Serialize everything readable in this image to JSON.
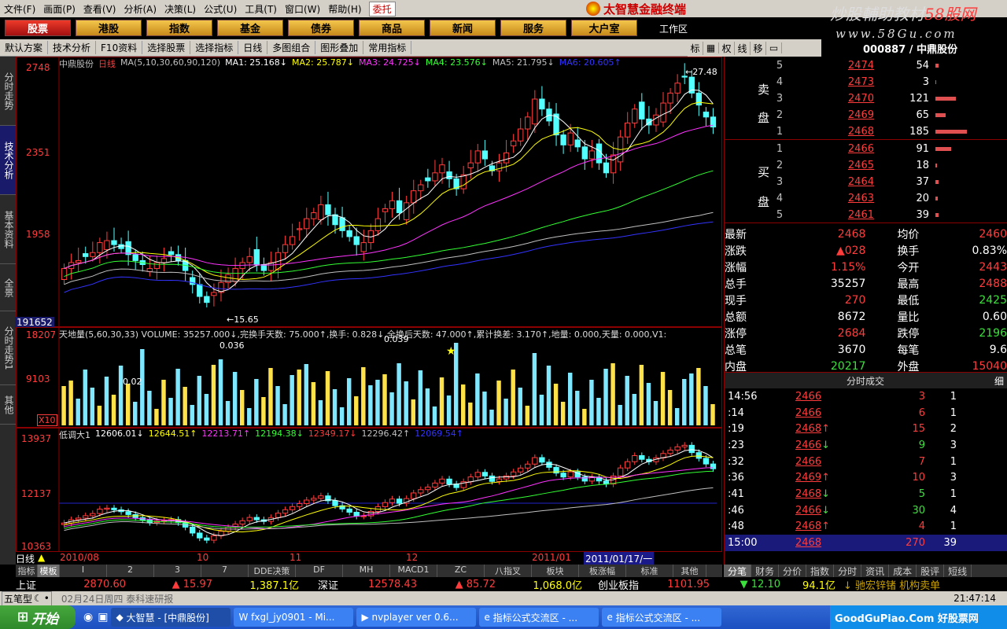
{
  "menu": [
    "文件(F)",
    "画面(P)",
    "查看(V)",
    "分析(A)",
    "决策(L)",
    "公式(U)",
    "工具(T)",
    "窗口(W)",
    "帮助(H)"
  ],
  "entrust": "委托",
  "brand": "太智慧金融终端",
  "watermark": {
    "line1a": "炒股輔助教材",
    "line1b": "58股网",
    "line2": "www.58Gu.com"
  },
  "nav": [
    "股票",
    "港股",
    "指数",
    "基金",
    "债券",
    "商品",
    "新闻",
    "服务",
    "大户室"
  ],
  "workspace": "工作区",
  "toolbar": [
    "默认方案",
    "技术分析",
    "F10资料",
    "选择股票",
    "选择指标",
    "日线",
    "多图组合",
    "图形叠加",
    "常用指标"
  ],
  "toolbar2": [
    "标",
    "",
    "权",
    "线",
    "移",
    ""
  ],
  "lefttabs": [
    "分时走势",
    "技术分析",
    "基本资料",
    "全景",
    "分时走势1",
    "其他"
  ],
  "main": {
    "info_name": "中鼎股份",
    "info_period": "日线",
    "info_ma": "MA(5,10,30,60,90,120)",
    "ma1": "MA1: 25.168↓",
    "ma2": "MA2: 25.787↓",
    "ma3": "MA3: 24.725↓",
    "ma4": "MA4: 23.576↓",
    "ma5": "MA5: 21.795↓",
    "ma6": "MA6: 20.605↑",
    "axis": [
      "2748",
      "2351",
      "1958"
    ],
    "high_label": "←27.48",
    "low_label": "←15.65",
    "corner_value": "191652"
  },
  "vol": {
    "header": "天地量(5,60,30,33) VOLUME: 35257.000↓,完换手天数: 75.000↑,换手: 0.828↓,全换后天数: 47.000↑,累计换差: 3.170↑,地量: 0.000,天量: 0.000,V1:",
    "axis": [
      "18207",
      "9103"
    ],
    "x10": "X10",
    "labels": [
      "0.036",
      "0.039",
      "0.02"
    ]
  },
  "ind": {
    "name": "低调大1",
    "values": [
      "12606.01↓",
      "12644.51↑",
      "12213.71↑",
      "12194.38↓",
      "12349.17↓",
      "12296.42↑",
      "12069.54↑"
    ],
    "axis": [
      "13937",
      "12137",
      "10363"
    ]
  },
  "dates": [
    "2010/08",
    "10",
    "11",
    "12",
    "2011/01",
    "2011/01/17/一"
  ],
  "period": "日线",
  "bottomtabs": [
    "指标",
    "模板",
    "I",
    "2",
    "3",
    "7",
    "DDE决策",
    "DF",
    "MH",
    "MACD1",
    "ZC",
    "八指叉",
    "板块",
    "板涨幅",
    "标准",
    "其他"
  ],
  "quote": {
    "code": "000887 / 中鼎股份",
    "sell_label": [
      "卖",
      "盘"
    ],
    "buy_label": [
      "买",
      "盘"
    ],
    "sell": [
      {
        "level": "5",
        "price": "2474",
        "vol": "54",
        "bar": 0.09
      },
      {
        "level": "4",
        "price": "2473",
        "vol": "3",
        "bar": 0.02
      },
      {
        "level": "3",
        "price": "2470",
        "vol": "121",
        "bar": 0.6
      },
      {
        "level": "2",
        "price": "2469",
        "vol": "65",
        "bar": 0.3
      },
      {
        "level": "1",
        "price": "2468",
        "vol": "185",
        "bar": 0.92
      }
    ],
    "buy": [
      {
        "level": "1",
        "price": "2466",
        "vol": "91",
        "bar": 0.45
      },
      {
        "level": "2",
        "price": "2465",
        "vol": "18",
        "bar": 0.05
      },
      {
        "level": "3",
        "price": "2464",
        "vol": "37",
        "bar": 0.1
      },
      {
        "level": "4",
        "price": "2463",
        "vol": "20",
        "bar": 0.06
      },
      {
        "level": "5",
        "price": "2461",
        "vol": "39",
        "bar": 0.1
      }
    ],
    "stats": [
      {
        "k1": "最新",
        "v1": "2468",
        "c1": "#ff3c3c",
        "k2": "均价",
        "v2": "2460",
        "c2": "#ff3c3c"
      },
      {
        "k1": "涨跌",
        "v1": "▲028",
        "c1": "#ff3c3c",
        "k2": "换手",
        "v2": "0.83%",
        "c2": "#fff"
      },
      {
        "k1": "涨幅",
        "v1": "1.15%",
        "c1": "#ff3c3c",
        "k2": "今开",
        "v2": "2443",
        "c2": "#ff3c3c"
      },
      {
        "k1": "总手",
        "v1": "35257",
        "c1": "#fff",
        "k2": "最高",
        "v2": "2488",
        "c2": "#ff3c3c"
      },
      {
        "k1": "现手",
        "v1": "270",
        "c1": "#ff3c3c",
        "k2": "最低",
        "v2": "2425",
        "c2": "#3ce03c"
      },
      {
        "k1": "总额",
        "v1": "8672",
        "c1": "#fff",
        "k2": "量比",
        "v2": "0.60",
        "c2": "#fff"
      },
      {
        "k1": "涨停",
        "v1": "2684",
        "c1": "#ff3c3c",
        "k2": "跌停",
        "v2": "2196",
        "c2": "#3ce03c"
      },
      {
        "k1": "总笔",
        "v1": "3670",
        "c1": "#fff",
        "k2": "每笔",
        "v2": "9.6",
        "c2": "#fff"
      },
      {
        "k1": "内盘",
        "v1": "20217",
        "c1": "#3ce03c",
        "k2": "外盘",
        "v2": "15040",
        "c2": "#ff3c3c"
      }
    ],
    "trades_header": "分时成交",
    "trades_btn": "细",
    "trades": [
      {
        "t": "14:56",
        "p": "2466",
        "a": "",
        "q": "3",
        "qc": "#ff3c3c",
        "n": "1"
      },
      {
        "t": ":14",
        "p": "2466",
        "a": "",
        "q": "6",
        "qc": "#ff3c3c",
        "n": "1"
      },
      {
        "t": ":19",
        "p": "2468",
        "a": "↑",
        "q": "15",
        "qc": "#ff3c3c",
        "n": "2"
      },
      {
        "t": ":23",
        "p": "2466",
        "a": "↓",
        "q": "9",
        "qc": "#3ce03c",
        "n": "3"
      },
      {
        "t": ":32",
        "p": "2466",
        "a": "",
        "q": "7",
        "qc": "#ff3c3c",
        "n": "1"
      },
      {
        "t": ":36",
        "p": "2469",
        "a": "↑",
        "q": "10",
        "qc": "#ff3c3c",
        "n": "3"
      },
      {
        "t": ":41",
        "p": "2468",
        "a": "↓",
        "q": "5",
        "qc": "#3ce03c",
        "n": "1"
      },
      {
        "t": ":46",
        "p": "2466",
        "a": "↓",
        "q": "30",
        "qc": "#3ce03c",
        "n": "4"
      },
      {
        "t": ":48",
        "p": "2468",
        "a": "↑",
        "q": "4",
        "qc": "#ff3c3c",
        "n": "1"
      }
    ],
    "last_trade": {
      "t": "15:00",
      "p": "2468",
      "q": "270",
      "n": "39"
    }
  },
  "righttabs": [
    "分笔",
    "财务",
    "分价",
    "指数",
    "分时",
    "资讯",
    "成本",
    "股评",
    "短线"
  ],
  "ticker": {
    "sh_name": "上证",
    "sh_val": "2870.60",
    "sh_chg": "▲ 15.97",
    "sh_amt": "1,387.1亿",
    "sz_name": "深证",
    "sz_val": "12578.43",
    "sz_chg": "▲ 85.72",
    "sz_amt": "1,068.0亿",
    "cy_name": "创业板指",
    "cy_val": "1101.95",
    "cy_chg": "▼ 12.10",
    "cy_amt": "94.1亿",
    "news": "↓ 驰宏锌锗 机构卖单"
  },
  "status": {
    "wubi": "五笔型",
    "info": "02月24日周四 泰科速研报",
    "time": "21:47:14"
  },
  "taskbar": {
    "start": "开始",
    "tasks": [
      "大智慧 - [中鼎股份]",
      "fxgl_jy0901 - Mi...",
      "nvplayer ver 0.6...",
      "指标公式交流区 - ...",
      "指标公式交流区 - ..."
    ],
    "tray": "GoodGuPiao.Com 好股票网"
  },
  "chart_data": {
    "type": "candlestick",
    "title": "中鼎股份 日线",
    "ylim": [
      15.65,
      27.48
    ],
    "x_labels": [
      "2010/08",
      "10",
      "11",
      "12",
      "2011/01"
    ],
    "high": 27.48,
    "low": 15.65,
    "last": 24.68,
    "ma": {
      "MA1": 25.168,
      "MA2": 25.787,
      "MA3": 24.725,
      "MA4": 23.576,
      "MA5": 21.795,
      "MA6": 20.605
    },
    "closes": [
      17.6,
      17.9,
      18.0,
      18.2,
      18.4,
      18.9,
      19.0,
      18.8,
      18.6,
      18.3,
      18.0,
      17.8,
      17.6,
      17.9,
      18.1,
      18.3,
      18.0,
      17.5,
      16.8,
      16.2,
      15.9,
      16.4,
      16.9,
      17.3,
      17.6,
      17.9,
      18.2,
      17.8,
      17.5,
      17.9,
      18.4,
      18.8,
      19.2,
      19.6,
      20.1,
      20.4,
      20.8,
      20.3,
      19.8,
      19.5,
      19.2,
      18.8,
      18.9,
      19.5,
      20.1,
      20.6,
      21.0,
      20.4,
      20.9,
      21.5,
      21.8,
      22.0,
      22.4,
      22.8,
      22.1,
      21.6,
      22.3,
      22.9,
      23.5,
      23.1,
      22.5,
      22.9,
      23.4,
      24.0,
      24.6,
      25.2,
      26.1,
      25.6,
      25.0,
      24.3,
      23.8,
      24.4,
      23.7,
      23.1,
      23.5,
      22.9,
      22.4,
      23.3,
      24.2,
      24.9,
      25.6,
      25.1,
      24.8,
      25.3,
      25.9,
      26.4,
      26.9,
      27.2,
      26.4,
      25.8,
      25.2,
      24.7
    ],
    "volume_axis": [
      18207,
      9103
    ],
    "indicator_axis": [
      13937,
      12137,
      10363
    ]
  }
}
